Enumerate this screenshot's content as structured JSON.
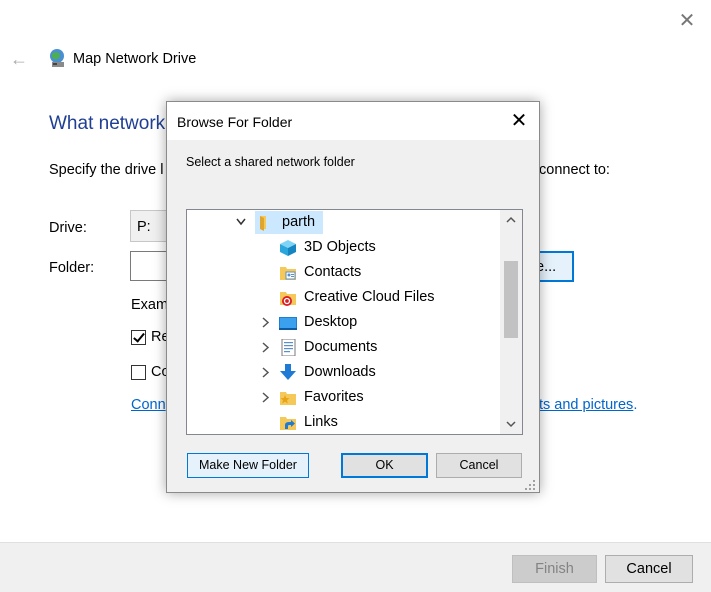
{
  "wizard": {
    "window_title": "Map Network Drive",
    "heading": "What network",
    "description_left": "Specify the drive l",
    "description_right": "connect to:",
    "drive_label": "Drive:",
    "drive_value": "P:",
    "folder_label": "Folder:",
    "browse_button_fragment": "e...",
    "example_text": "Exam",
    "checkbox_reconnect": {
      "label": "Re",
      "checked": true
    },
    "checkbox_credentials": {
      "label": "Co",
      "checked": false
    },
    "link_left": "Conn",
    "link_right": "ts and pictures",
    "link_right_suffix": ".",
    "finish_button": "Finish",
    "cancel_button": "Cancel"
  },
  "dialog": {
    "title": "Browse For Folder",
    "prompt": "Select a shared network folder",
    "tree": [
      {
        "label": "parth",
        "expanded": true,
        "selected": true,
        "icon": "user-folder-icon"
      },
      {
        "label": "3D Objects",
        "icon": "3d-objects-icon"
      },
      {
        "label": "Contacts",
        "icon": "contacts-icon"
      },
      {
        "label": "Creative Cloud Files",
        "icon": "creative-cloud-icon"
      },
      {
        "label": "Desktop",
        "icon": "desktop-icon",
        "expandable": true
      },
      {
        "label": "Documents",
        "icon": "documents-icon",
        "expandable": true
      },
      {
        "label": "Downloads",
        "icon": "downloads-icon",
        "expandable": true
      },
      {
        "label": "Favorites",
        "icon": "favorites-icon",
        "expandable": true
      },
      {
        "label": "Links",
        "icon": "links-icon"
      }
    ],
    "buttons": {
      "new_folder": "Make New Folder",
      "ok": "OK",
      "cancel": "Cancel"
    }
  },
  "colors": {
    "accent": "#0078d7",
    "heading": "#1e3f93",
    "link": "#0066cc",
    "selection": "#cce8ff"
  }
}
